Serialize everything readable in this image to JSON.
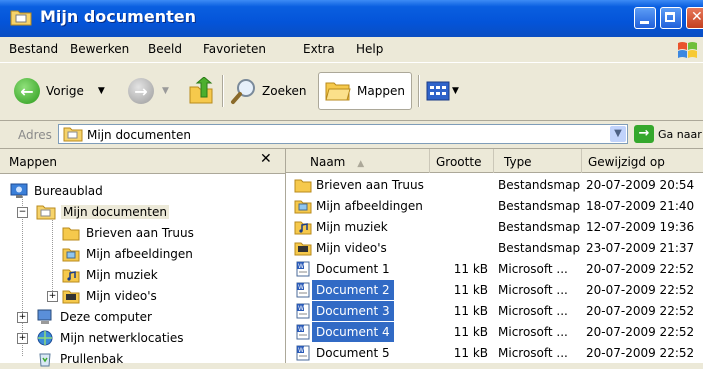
{
  "window": {
    "title": "Mijn documenten"
  },
  "menu": [
    "Bestand",
    "Bewerken",
    "Beeld",
    "Favorieten",
    "Extra",
    "Help"
  ],
  "toolbar": {
    "back": "Vorige",
    "search": "Zoeken",
    "folders": "Mappen"
  },
  "address": {
    "label": "Adres",
    "value": "Mijn documenten",
    "go": "Ga naar"
  },
  "folders_pane": {
    "title": "Mappen",
    "close": "✕",
    "items": [
      {
        "label": "Bureaublad"
      },
      {
        "label": "Mijn documenten"
      },
      {
        "label": "Brieven aan Truus"
      },
      {
        "label": "Mijn afbeeldingen"
      },
      {
        "label": "Mijn muziek"
      },
      {
        "label": "Mijn video's"
      },
      {
        "label": "Deze computer"
      },
      {
        "label": "Mijn netwerklocaties"
      },
      {
        "label": "Prullenbak"
      }
    ]
  },
  "columns": {
    "name": "Naam",
    "size": "Grootte",
    "type": "Type",
    "modified": "Gewijzigd op"
  },
  "files": [
    {
      "name": "Brieven aan Truus",
      "size": "",
      "type": "Bestandsmap",
      "modified": "20-07-2009 20:54"
    },
    {
      "name": "Mijn afbeeldingen",
      "size": "",
      "type": "Bestandsmap",
      "modified": "18-07-2009 21:40"
    },
    {
      "name": "Mijn muziek",
      "size": "",
      "type": "Bestandsmap",
      "modified": "12-07-2009 19:36"
    },
    {
      "name": "Mijn video's",
      "size": "",
      "type": "Bestandsmap",
      "modified": "23-07-2009 21:37"
    },
    {
      "name": "Document 1",
      "size": "11 kB",
      "type": "Microsoft ...",
      "modified": "20-07-2009 22:52"
    },
    {
      "name": "Document 2",
      "size": "11 kB",
      "type": "Microsoft ...",
      "modified": "20-07-2009 22:52"
    },
    {
      "name": "Document 3",
      "size": "11 kB",
      "type": "Microsoft ...",
      "modified": "20-07-2009 22:52"
    },
    {
      "name": "Document 4",
      "size": "11 kB",
      "type": "Microsoft ...",
      "modified": "20-07-2009 22:52"
    },
    {
      "name": "Document 5",
      "size": "11 kB",
      "type": "Microsoft ...",
      "modified": "20-07-2009 22:52"
    }
  ],
  "colors": {
    "title_bar": "#0454d9",
    "selection": "#316ac5",
    "chrome": "#ece9d8"
  }
}
